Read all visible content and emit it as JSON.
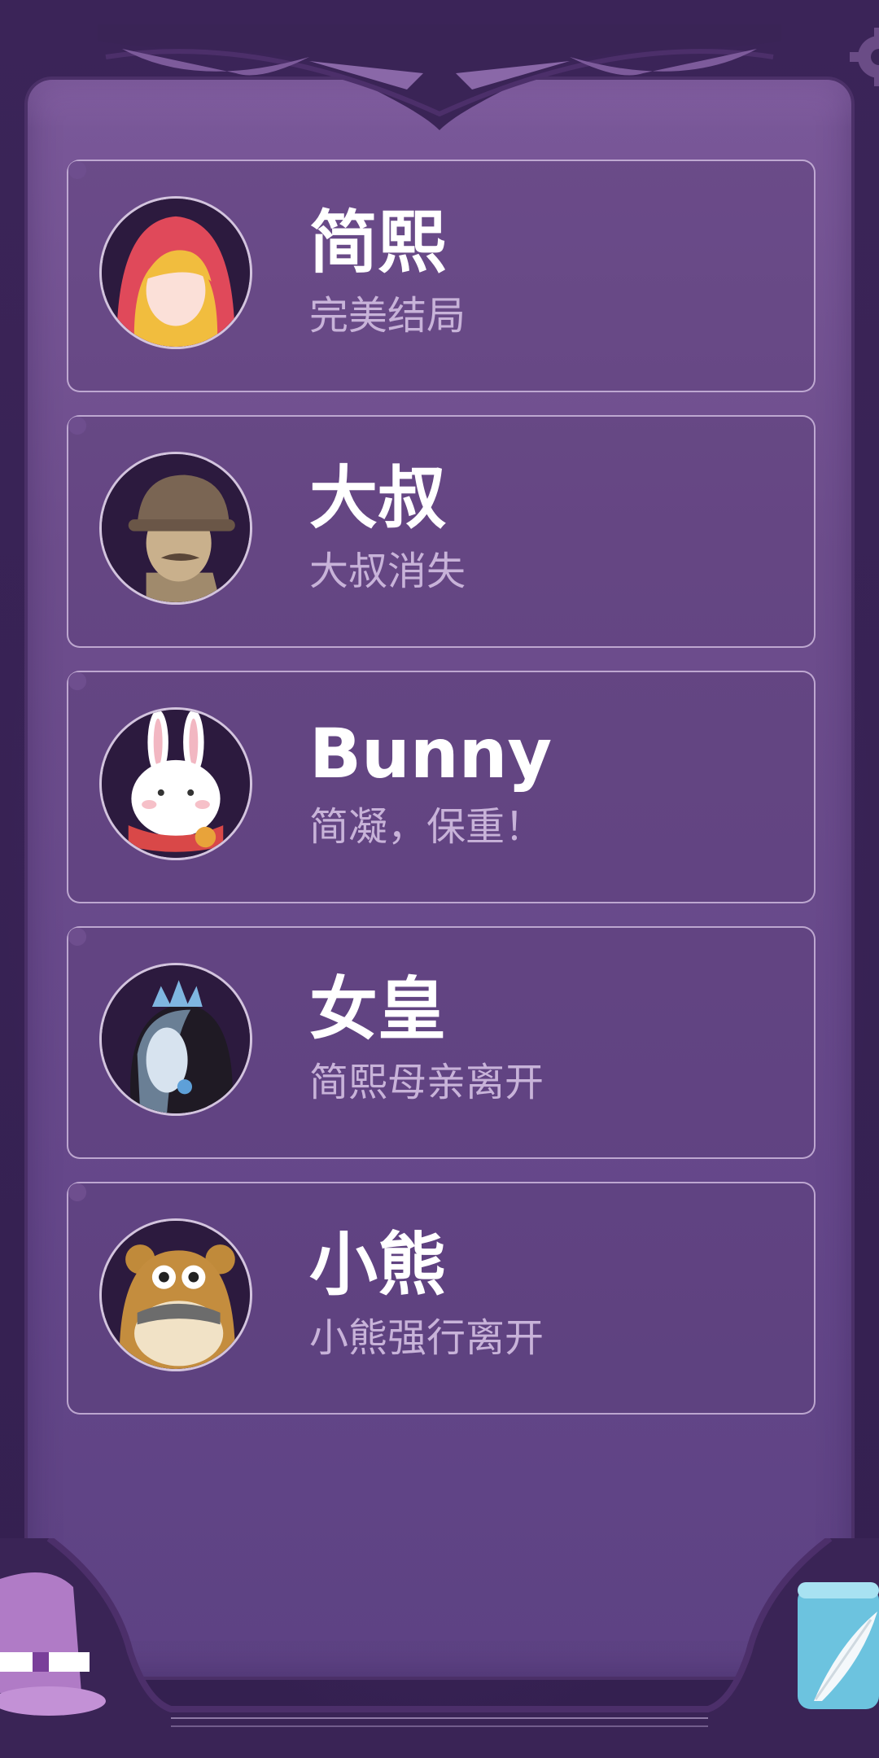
{
  "characters": [
    {
      "name": "简熙",
      "ending": "完美结局",
      "avatar": "red-hood-girl-icon"
    },
    {
      "name": "大叔",
      "ending": "大叔消失",
      "avatar": "uncle-cap-icon"
    },
    {
      "name": "Bunny",
      "ending": "简凝，保重！",
      "avatar": "bunny-icon"
    },
    {
      "name": "女皇",
      "ending": "简熙母亲离开",
      "avatar": "queen-icon"
    },
    {
      "name": "小熊",
      "ending": "小熊强行离开",
      "avatar": "bear-icon"
    }
  ],
  "icons": {
    "settings": "gear-icon",
    "hat": "magic-hat-icon",
    "quill": "scroll-quill-icon"
  },
  "colors": {
    "background": "#3a2456",
    "panel": "#6d4d8c",
    "name": "#ffffff",
    "subtitle": "#c8b3d9"
  }
}
